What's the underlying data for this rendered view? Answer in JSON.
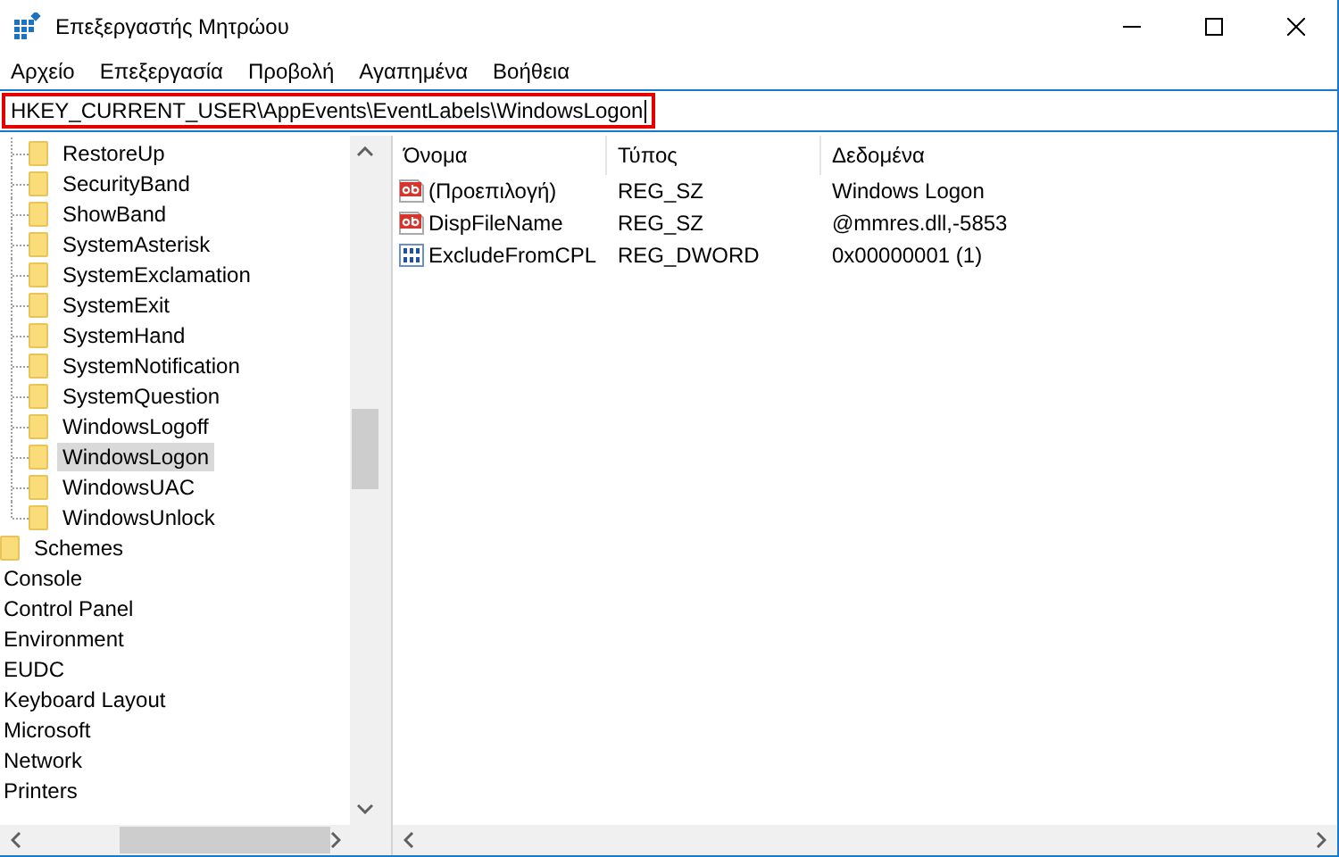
{
  "window": {
    "title": "Επεξεργαστής Μητρώου"
  },
  "menu": [
    "Αρχείο",
    "Επεξεργασία",
    "Προβολή",
    "Αγαπημένα",
    "Βοήθεια"
  ],
  "address": {
    "value": "HKEY_CURRENT_USER\\AppEvents\\EventLabels\\WindowsLogon",
    "highlighted": true
  },
  "tree": {
    "nested_items": [
      {
        "label": "RestoreUp",
        "selected": false
      },
      {
        "label": "SecurityBand",
        "selected": false
      },
      {
        "label": "ShowBand",
        "selected": false
      },
      {
        "label": "SystemAsterisk",
        "selected": false
      },
      {
        "label": "SystemExclamation",
        "selected": false
      },
      {
        "label": "SystemExit",
        "selected": false
      },
      {
        "label": "SystemHand",
        "selected": false
      },
      {
        "label": "SystemNotification",
        "selected": false
      },
      {
        "label": "SystemQuestion",
        "selected": false
      },
      {
        "label": "WindowsLogoff",
        "selected": false
      },
      {
        "label": "WindowsLogon",
        "selected": true
      },
      {
        "label": "WindowsUAC",
        "selected": false
      },
      {
        "label": "WindowsUnlock",
        "selected": false
      }
    ],
    "sibling_items": [
      {
        "label": "Schemes",
        "selected": false
      }
    ],
    "top_items": [
      {
        "label": "Console",
        "selected": false
      },
      {
        "label": "Control Panel",
        "selected": false
      },
      {
        "label": "Environment",
        "selected": false
      },
      {
        "label": "EUDC",
        "selected": false
      },
      {
        "label": "Keyboard Layout",
        "selected": false
      },
      {
        "label": "Microsoft",
        "selected": false
      },
      {
        "label": "Network",
        "selected": false
      },
      {
        "label": "Printers",
        "selected": false
      }
    ]
  },
  "values": {
    "columns": [
      "Όνομα",
      "Τύπος",
      "Δεδομένα"
    ],
    "rows": [
      {
        "kind": "string",
        "name": "(Προεπιλογή)",
        "type": "REG_SZ",
        "data": "Windows Logon"
      },
      {
        "kind": "string",
        "name": "DispFileName",
        "type": "REG_SZ",
        "data": "@mmres.dll,-5853"
      },
      {
        "kind": "binary",
        "name": "ExcludeFromCPL",
        "type": "REG_DWORD",
        "data": "0x00000001 (1)"
      }
    ]
  }
}
